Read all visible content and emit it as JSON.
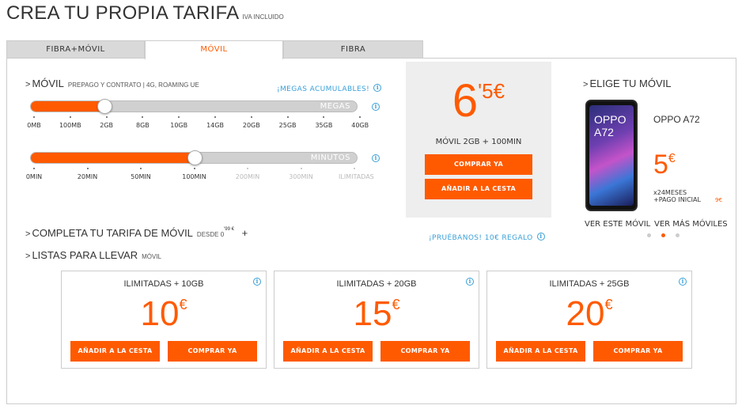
{
  "header": {
    "title": "CREA TU PROPIA TARIFA",
    "subtitle": "IVA INCLUIDO"
  },
  "tabs": [
    {
      "label": "FIBRA+MÓVIL",
      "active": false
    },
    {
      "label": "MÓVIL",
      "active": true
    },
    {
      "label": "FIBRA",
      "active": false
    }
  ],
  "movil": {
    "heading": "MÓVIL",
    "heading_note": "PREPAGO Y CONTRATO | 4G, ROAMING UE",
    "accum_link": "¡MEGAS ACUMULABLES!",
    "data_slider": {
      "label": "MEGAS",
      "ticks": [
        "0MB",
        "100MB",
        "2GB",
        "8GB",
        "10GB",
        "14GB",
        "20GB",
        "25GB",
        "35GB",
        "40GB"
      ],
      "selected": "2GB",
      "selected_index": 2
    },
    "minutes_slider": {
      "label": "MINUTOS",
      "ticks": [
        "0MIN",
        "20MIN",
        "50MIN",
        "100MIN",
        "200MIN",
        "300MIN",
        "ILIMITADAS"
      ],
      "selected": "100MIN",
      "selected_index": 3,
      "enabled_count": 4
    }
  },
  "summary": {
    "price_int": "6",
    "price_dec": "'5",
    "currency": "€",
    "plan": "MÓVIL 2GB + 100MIN",
    "buy_label": "COMPRAR YA",
    "cart_label": "AÑADIR A LA CESTA",
    "try_link": "¡PRUÉBANOS! 10€ REGALO"
  },
  "phone": {
    "heading": "ELIGE TU MÓVIL",
    "screen_text_1": "OPPO",
    "screen_text_2": "A72",
    "name": "OPPO A72",
    "price": "5",
    "currency": "€",
    "terms_1": "x24MESES",
    "terms_2": "+PAGO INICIAL",
    "initial_payment": "9€",
    "view_link": "VER ESTE MÓVIL",
    "more_link": "VER MÁS MÓVILES",
    "carousel_dots": 3,
    "carousel_active": 1
  },
  "complete": {
    "heading": "COMPLETA TU TARIFA DE MÓVIL",
    "from_label": "DESDE 0",
    "from_dec": "'99 €",
    "plus": "+"
  },
  "ready": {
    "heading": "LISTAS PARA LLEVAR",
    "heading_note": "MÓVIL",
    "cards": [
      {
        "title": "ILIMITADAS + 10GB",
        "price": "10",
        "currency": "€",
        "cart_label": "AÑADIR A LA CESTA",
        "buy_label": "COMPRAR YA"
      },
      {
        "title": "ILIMITADAS + 20GB",
        "price": "15",
        "currency": "€",
        "cart_label": "AÑADIR A LA CESTA",
        "buy_label": "COMPRAR YA"
      },
      {
        "title": "ILIMITADAS + 25GB",
        "price": "20",
        "currency": "€",
        "cart_label": "AÑADIR A LA CESTA",
        "buy_label": "COMPRAR YA"
      }
    ]
  },
  "icons": {
    "info": "info-icon",
    "chevron": "chevron-right-icon"
  },
  "colors": {
    "accent": "#ff5a00",
    "link": "#3aa0d8",
    "panel_bg": "#eeeeee"
  }
}
